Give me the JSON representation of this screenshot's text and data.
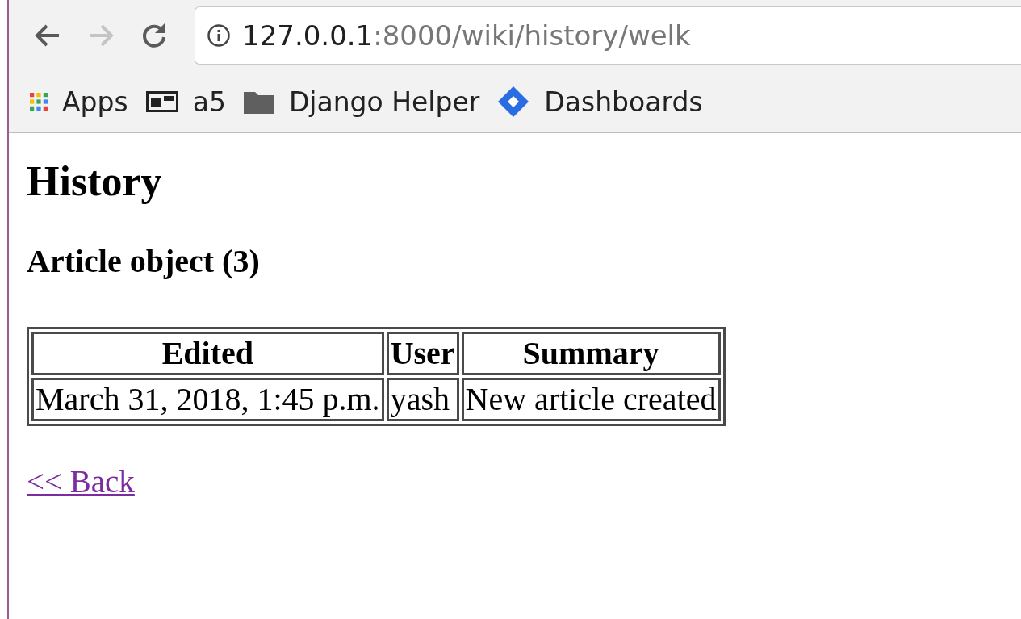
{
  "browser": {
    "back_enabled": true,
    "forward_enabled": false,
    "url": {
      "host": "127.0.0.1",
      "path": ":8000/wiki/history/welk"
    },
    "bookmarks": [
      {
        "kind": "apps",
        "label": "Apps"
      },
      {
        "kind": "board",
        "label": "a5"
      },
      {
        "kind": "folder",
        "label": "Django Helper"
      },
      {
        "kind": "diamond",
        "label": "Dashboards"
      }
    ]
  },
  "page": {
    "title": "History",
    "subtitle": "Article object (3)",
    "table": {
      "columns": [
        "Edited",
        "User",
        "Summary"
      ],
      "rows": [
        [
          "March 31, 2018, 1:45 p.m.",
          "yash",
          "New article created"
        ]
      ]
    },
    "back_link": {
      "label": "<< Back",
      "visited": true
    }
  }
}
